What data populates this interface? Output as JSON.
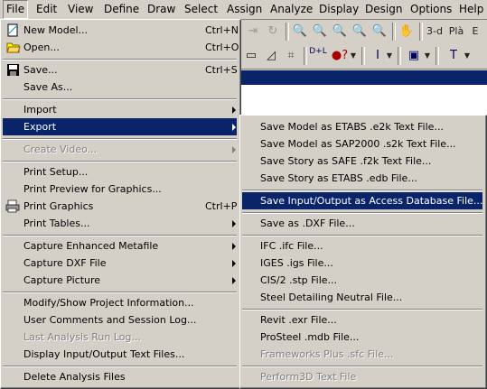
{
  "menubar": {
    "items": [
      "File",
      "Edit",
      "View",
      "Define",
      "Draw",
      "Select",
      "Assign",
      "Analyze",
      "Display",
      "Design",
      "Options",
      "Help"
    ]
  },
  "toolbar": {
    "view_3d": "3-d",
    "plan": "Plà",
    "elev": "E"
  },
  "file_menu": {
    "items": [
      {
        "label": "New Model...",
        "shortcut": "Ctrl+N",
        "icon": "new-model-icon"
      },
      {
        "label": "Open...",
        "shortcut": "Ctrl+O",
        "icon": "open-folder-icon"
      },
      {
        "label": "Save...",
        "shortcut": "Ctrl+S",
        "icon": "floppy-disk-icon"
      },
      {
        "label": "Save As..."
      },
      {
        "label": "Import"
      },
      {
        "label": "Export"
      },
      {
        "label": "Create Video..."
      },
      {
        "label": "Print Setup..."
      },
      {
        "label": "Print Preview for Graphics..."
      },
      {
        "label": "Print Graphics",
        "shortcut": "Ctrl+P",
        "icon": "printer-icon"
      },
      {
        "label": "Print Tables..."
      },
      {
        "label": "Capture Enhanced Metafile"
      },
      {
        "label": "Capture DXF File"
      },
      {
        "label": "Capture Picture"
      },
      {
        "label": "Modify/Show Project Information..."
      },
      {
        "label": "User Comments and Session Log..."
      },
      {
        "label": "Last Analysis Run Log..."
      },
      {
        "label": "Display Input/Output Text Files..."
      },
      {
        "label": "Delete Analysis Files"
      }
    ]
  },
  "export_menu": {
    "items": [
      {
        "label": "Save Model as ETABS .e2k Text File..."
      },
      {
        "label": "Save Model as SAP2000 .s2k Text File..."
      },
      {
        "label": "Save Story as SAFE .f2k Text File..."
      },
      {
        "label": "Save Story as ETABS .edb File..."
      },
      {
        "label": "Save Input/Output as Access Database File..."
      },
      {
        "label": "Save as .DXF File..."
      },
      {
        "label": "IFC .ifc File..."
      },
      {
        "label": "IGES .igs File..."
      },
      {
        "label": "CIS/2 .stp File..."
      },
      {
        "label": "Steel Detailing Neutral File..."
      },
      {
        "label": "Revit .exr File..."
      },
      {
        "label": "ProSteel .mdb File..."
      },
      {
        "label": "Frameworks Plus .sfc File..."
      },
      {
        "label": "Perform3D Text File"
      }
    ]
  }
}
